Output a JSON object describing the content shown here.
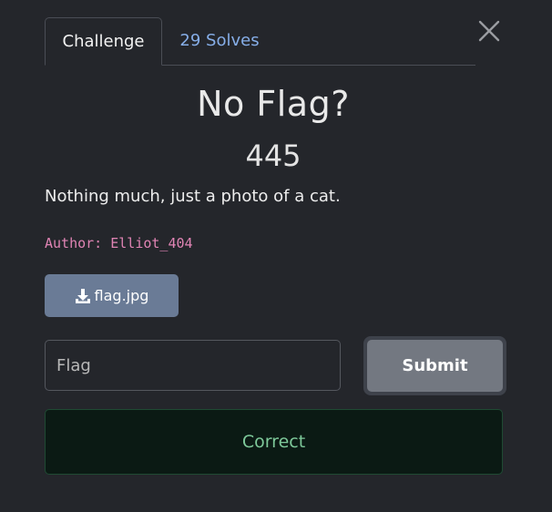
{
  "tabs": {
    "challenge_label": "Challenge",
    "solves_label": "29 Solves"
  },
  "challenge": {
    "title": "No Flag?",
    "points": "445",
    "description": "Nothing much, just a photo of a cat.",
    "author": "Author: Elliot_404"
  },
  "file": {
    "name": "flag.jpg",
    "icon": "download-icon"
  },
  "form": {
    "placeholder": "Flag",
    "value": "",
    "submit_label": "Submit"
  },
  "result": {
    "message": "Correct"
  },
  "colors": {
    "background": "#24262b",
    "tab_link": "#86aee8",
    "author": "#e084b4",
    "file_button": "#6a7b96",
    "submit_button": "#737881",
    "success_bg": "#0b1a14",
    "success_text": "#7ec99a"
  }
}
